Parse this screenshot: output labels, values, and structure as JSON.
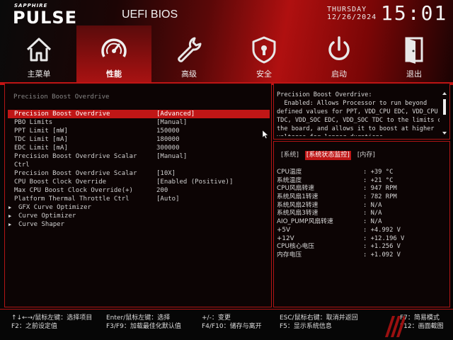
{
  "brand": {
    "small": "SAPPHIRE",
    "main": "PULSE",
    "title": "UEFI BIOS"
  },
  "datetime": {
    "day": "THURSDAY",
    "date": "12/26/2024",
    "time": "15:01"
  },
  "nav": [
    {
      "label": "主菜单",
      "icon": "home-icon"
    },
    {
      "label": "性能",
      "icon": "speedometer-icon",
      "active": true
    },
    {
      "label": "高级",
      "icon": "wrench-icon"
    },
    {
      "label": "安全",
      "icon": "shield-icon"
    },
    {
      "label": "启动",
      "icon": "power-icon"
    },
    {
      "label": "退出",
      "icon": "exit-door-icon"
    }
  ],
  "section_title": "Precision Boost Overdrive",
  "menu": [
    {
      "label": "Precision Boost Overdrive",
      "value": "[Advanced]",
      "selected": true
    },
    {
      "label": "PBO Limits",
      "value": "[Manual]"
    },
    {
      "label": "PPT Limit [mW]",
      "value": "150000"
    },
    {
      "label": "TDC Limit [mA]",
      "value": "180000"
    },
    {
      "label": "EDC Limit [mA]",
      "value": "300000"
    },
    {
      "label": "Precision Boost Overdrive Scalar",
      "label2": "Ctrl",
      "value": "[Manual]"
    },
    {
      "label": "Precision Boost Overdrive Scalar",
      "value": "[10X]"
    },
    {
      "label": "CPU Boost Clock Override",
      "value": "[Enabled (Positive)]"
    },
    {
      "label": "Max CPU Boost Clock Override(+)",
      "value": "200"
    },
    {
      "label": "Platform Thermal Throttle Ctrl",
      "value": "[Auto]"
    },
    {
      "label": "GFX Curve Optimizer"
    },
    {
      "label": "Curve Optimizer"
    },
    {
      "label": "Curve Shaper"
    }
  ],
  "help": {
    "text": "Precision Boost Overdrive:\n  Enabled: Allows Processor to run beyond\ndefined values for PPT, VDD_CPU EDC, VDD_CPU\nTDC, VDD_SOC EDC, VDD_SOC TDC to the limits of\nthe board, and allows it to boost at higher\nvoltages for longer durations."
  },
  "monitor": {
    "tabs": [
      "[系统]",
      "[系统状态监控]",
      "[内存]"
    ],
    "active_tab": 1,
    "rows": [
      {
        "label": "CPU温度",
        "value": ": +39 °C"
      },
      {
        "label": "系统温度",
        "value": ": +21 °C"
      },
      {
        "label": "CPU风扇转速",
        "value": ": 947 RPM"
      },
      {
        "label": "系统风扇1转速",
        "value": ": 782 RPM"
      },
      {
        "label": "系统风扇2转速",
        "value": ": N/A"
      },
      {
        "label": "系统风扇3转速",
        "value": ": N/A"
      },
      {
        "label": "AIO_PUMP风扇转速",
        "value": ": N/A"
      },
      {
        "label": "+5V",
        "value": ": +4.992 V"
      },
      {
        "label": "+12V",
        "value": ": +12.196 V"
      },
      {
        "label": "CPU核心电压",
        "value": ": +1.256 V"
      },
      {
        "label": "内存电压",
        "value": ": +1.092 V"
      }
    ]
  },
  "footer": {
    "k1": "↑↓←→/鼠标左键：选择项目",
    "k2": "F2：之前设定值",
    "k3": "Enter/鼠标左键：选择",
    "k4": "F3/F9：加载最佳化默认值",
    "k5": "+/-：变更",
    "k6": "F4/F10：储存与离开",
    "k7": "ESC/鼠标右键：取消并返回",
    "k8": "F5：显示系统信息",
    "k9": "F7：简易模式",
    "k10": "F12：画面截图"
  },
  "colors": {
    "accent": "#c01616",
    "border": "#b31515"
  }
}
